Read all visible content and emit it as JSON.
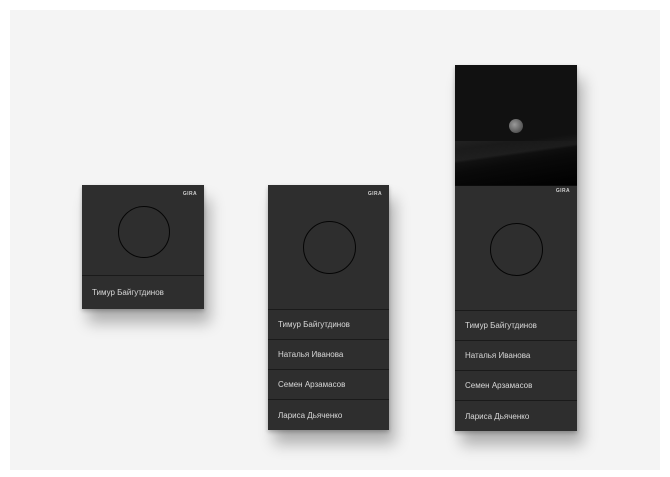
{
  "brand": "GIRA",
  "panels": {
    "small": {
      "names": [
        "Тимур Байгутдинов"
      ]
    },
    "medium": {
      "names": [
        "Тимур Байгутдинов",
        "Наталья Иванова",
        "Семен Арзамасов",
        "Лариса Дьяченко"
      ]
    },
    "large": {
      "names": [
        "Тимур Байгутдинов",
        "Наталья Иванова",
        "Семен Арзамасов",
        "Лариса Дьяченко"
      ]
    }
  },
  "colors": {
    "panel": "#2e2e2e",
    "text": "#d8d8d8",
    "background": "#f4f4f4"
  }
}
